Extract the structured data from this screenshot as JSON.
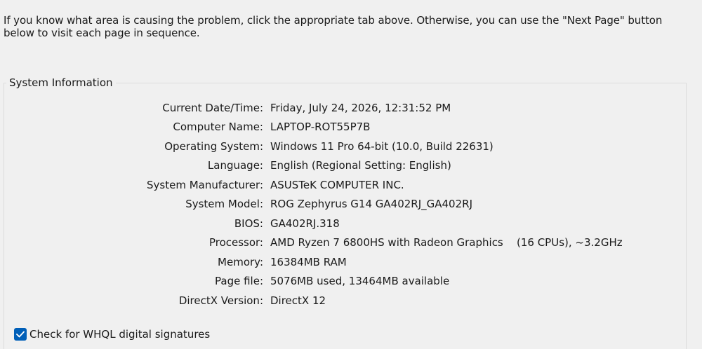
{
  "intro": {
    "text": "If you know what area is causing the problem, click the appropriate tab above.  Otherwise, you can use the \"Next Page\" button below to visit each page in sequence."
  },
  "system_info": {
    "title": "System Information",
    "rows": [
      {
        "label": "Current Date/Time:",
        "value": "Friday, July 24, 2026, 12:31:52 PM"
      },
      {
        "label": "Computer Name:",
        "value": "LAPTOP-ROT55P7B"
      },
      {
        "label": "Operating System:",
        "value": "Windows 11 Pro 64-bit (10.0, Build 22631)"
      },
      {
        "label": "Language:",
        "value": "English (Regional Setting: English)"
      },
      {
        "label": "System Manufacturer:",
        "value": "ASUSTeK COMPUTER INC."
      },
      {
        "label": "System Model:",
        "value": "ROG Zephyrus G14 GA402RJ_GA402RJ"
      },
      {
        "label": "BIOS:",
        "value": "GA402RJ.318"
      },
      {
        "label": "Processor:",
        "value": "AMD Ryzen 7 6800HS with Radeon Graphics",
        "extra": "(16 CPUs), ~3.2GHz"
      },
      {
        "label": "Memory:",
        "value": "16384MB RAM"
      },
      {
        "label": "Page file:",
        "value": "5076MB used, 13464MB available"
      },
      {
        "label": "DirectX Version:",
        "value": "DirectX 12"
      }
    ]
  },
  "whql": {
    "label": "Check for WHQL digital signatures",
    "checked": true,
    "accent_color": "#005fb8",
    "icon": "checkmark-icon"
  }
}
